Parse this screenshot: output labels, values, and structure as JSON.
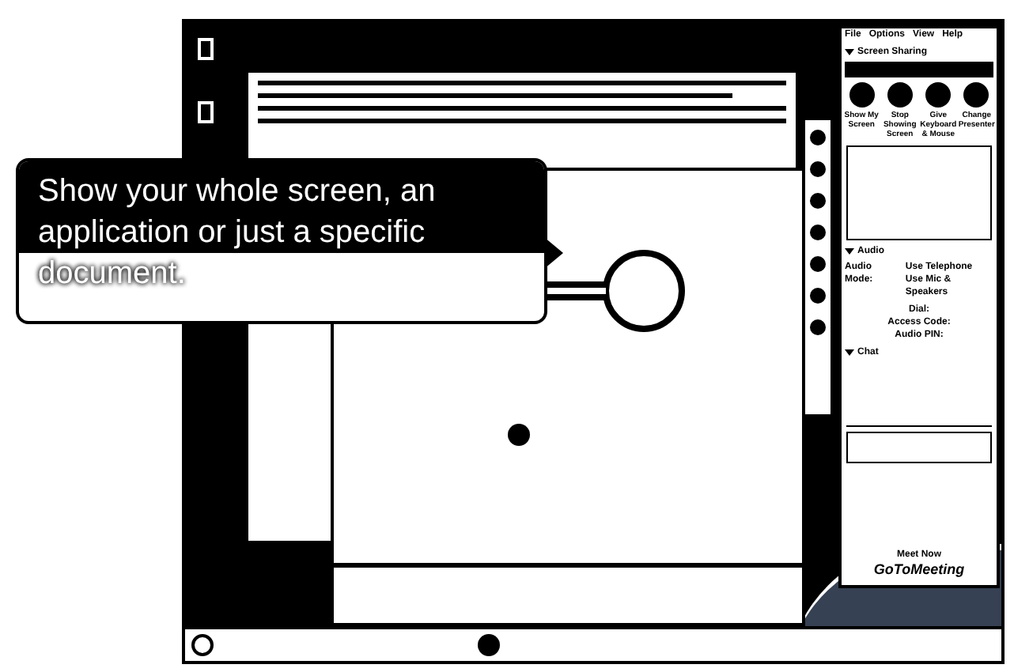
{
  "callout": {
    "text": "Show your whole screen, an application or just a specific document."
  },
  "panel": {
    "menu": [
      "File",
      "Options",
      "View",
      "Help"
    ],
    "sections": [
      {
        "title": "Screen Sharing",
        "expanded": true
      },
      {
        "title": "Audio",
        "expanded": true
      },
      {
        "title": "Chat",
        "expanded": true
      }
    ],
    "share_buttons": [
      {
        "label": "Show My Screen"
      },
      {
        "label": "Stop Showing Screen"
      },
      {
        "label": "Give Keyboard & Mouse"
      },
      {
        "label": "Change Presenter"
      }
    ],
    "audio": {
      "mode_label": "Audio Mode:",
      "options": [
        "Use Telephone",
        "Use Mic & Speakers"
      ],
      "dial_label": "Dial:",
      "access_label": "Access Code:",
      "pin_label": "Audio PIN:"
    },
    "footer": {
      "title": "Meet Now",
      "logo": "GoToMeeting"
    }
  }
}
